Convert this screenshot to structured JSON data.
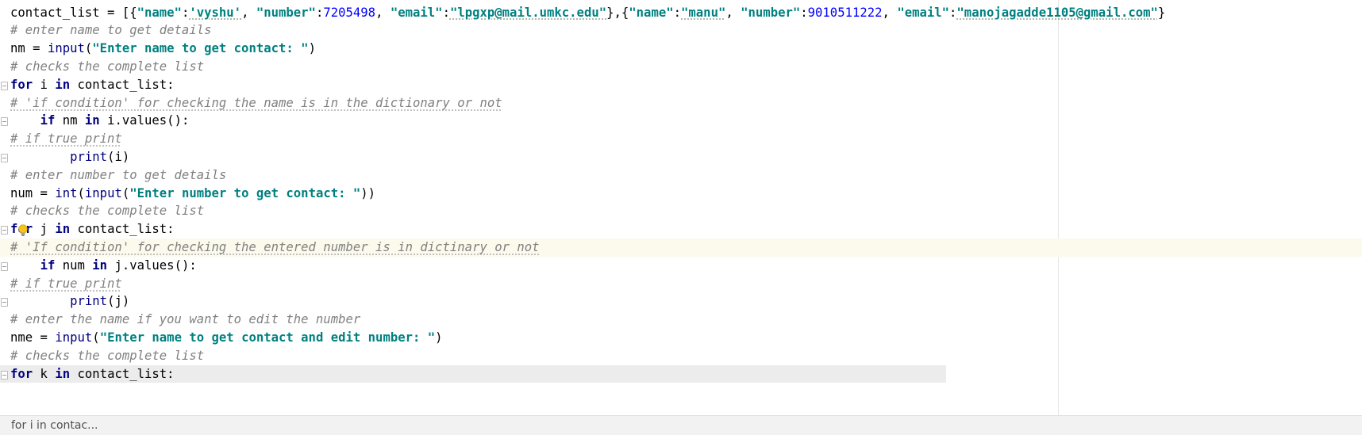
{
  "editor": {
    "lines": [
      {
        "fold": false,
        "tokens": [
          {
            "t": "contact_list = [{"
          },
          {
            "t": "\"name\"",
            "c": "str"
          },
          {
            "t": ":"
          },
          {
            "t": "'vyshu'",
            "c": "str squig"
          },
          {
            "t": ", "
          },
          {
            "t": "\"number\"",
            "c": "str"
          },
          {
            "t": ":"
          },
          {
            "t": "7205498",
            "c": "num"
          },
          {
            "t": ", "
          },
          {
            "t": "\"email\"",
            "c": "str"
          },
          {
            "t": ":"
          },
          {
            "t": "\"lpgxp@mail.umkc.edu\"",
            "c": "str squig"
          },
          {
            "t": "},{"
          },
          {
            "t": "\"name\"",
            "c": "str"
          },
          {
            "t": ":"
          },
          {
            "t": "\"manu\"",
            "c": "str squig"
          },
          {
            "t": ", "
          },
          {
            "t": "\"number\"",
            "c": "str"
          },
          {
            "t": ":"
          },
          {
            "t": "9010511222",
            "c": "num"
          },
          {
            "t": ", "
          },
          {
            "t": "\"email\"",
            "c": "str"
          },
          {
            "t": ":"
          },
          {
            "t": "\"manojagadde1105@gmail.com\"",
            "c": "str squig"
          },
          {
            "t": "}"
          }
        ]
      },
      {
        "fold": false,
        "tokens": [
          {
            "t": "# enter name to get details",
            "c": "cmt"
          }
        ]
      },
      {
        "fold": false,
        "tokens": [
          {
            "t": "nm = "
          },
          {
            "t": "input",
            "c": "bi"
          },
          {
            "t": "("
          },
          {
            "t": "\"Enter name to get contact: \"",
            "c": "str"
          },
          {
            "t": ")"
          }
        ]
      },
      {
        "fold": false,
        "tokens": [
          {
            "t": "# checks the complete list",
            "c": "cmt"
          }
        ]
      },
      {
        "fold": true,
        "tokens": [
          {
            "t": "for",
            "c": "kw"
          },
          {
            "t": " i "
          },
          {
            "t": "in",
            "c": "kw"
          },
          {
            "t": " contact_list:"
          }
        ]
      },
      {
        "fold": false,
        "tokens": [
          {
            "t": "# 'if condition' for checking the name is in the dictionary or not",
            "c": "cmt cmt-u"
          }
        ]
      },
      {
        "fold": true,
        "tokens": [
          {
            "t": "    "
          },
          {
            "t": "if",
            "c": "kw"
          },
          {
            "t": " nm "
          },
          {
            "t": "in",
            "c": "kw"
          },
          {
            "t": " i.values():"
          }
        ]
      },
      {
        "fold": false,
        "tokens": [
          {
            "t": "# if true print",
            "c": "cmt cmt-u"
          }
        ]
      },
      {
        "fold": true,
        "tokens": [
          {
            "t": "        "
          },
          {
            "t": "print",
            "c": "bi"
          },
          {
            "t": "(i)"
          }
        ]
      },
      {
        "fold": false,
        "tokens": [
          {
            "t": "# enter number to get details",
            "c": "cmt"
          }
        ]
      },
      {
        "fold": false,
        "tokens": [
          {
            "t": "num = "
          },
          {
            "t": "int",
            "c": "bi"
          },
          {
            "t": "("
          },
          {
            "t": "input",
            "c": "bi"
          },
          {
            "t": "("
          },
          {
            "t": "\"Enter number to get contact: \"",
            "c": "str"
          },
          {
            "t": "))"
          }
        ]
      },
      {
        "fold": false,
        "tokens": [
          {
            "t": "# checks the complete list",
            "c": "cmt"
          }
        ]
      },
      {
        "fold": true,
        "tokens": [
          {
            "t": "for",
            "c": "kw"
          },
          {
            "t": " j "
          },
          {
            "t": "in",
            "c": "kw"
          },
          {
            "t": " contact_list:"
          }
        ]
      },
      {
        "fold": false,
        "current": true,
        "tokens": [
          {
            "t": "# 'If condition' for checking the entered number is in dictinary or not",
            "c": "cmt cmt-u"
          }
        ]
      },
      {
        "fold": true,
        "tokens": [
          {
            "t": "    "
          },
          {
            "t": "if",
            "c": "kw"
          },
          {
            "t": " num "
          },
          {
            "t": "in",
            "c": "kw"
          },
          {
            "t": " j.values():"
          }
        ]
      },
      {
        "fold": false,
        "tokens": [
          {
            "t": "# if true print",
            "c": "cmt cmt-u"
          }
        ]
      },
      {
        "fold": true,
        "tokens": [
          {
            "t": "        "
          },
          {
            "t": "print",
            "c": "bi"
          },
          {
            "t": "(j)"
          }
        ]
      },
      {
        "fold": false,
        "tokens": [
          {
            "t": "# enter the name if you want to edit the number",
            "c": "cmt"
          }
        ]
      },
      {
        "fold": false,
        "tokens": [
          {
            "t": "nme = "
          },
          {
            "t": "input",
            "c": "bi"
          },
          {
            "t": "("
          },
          {
            "t": "\"Enter name to get contact and edit number: \"",
            "c": "str"
          },
          {
            "t": ")"
          }
        ]
      },
      {
        "fold": false,
        "tokens": [
          {
            "t": "# checks the complete list",
            "c": "cmt"
          }
        ]
      },
      {
        "fold": true,
        "sticky": true,
        "tokens": [
          {
            "t": "for",
            "c": "kw"
          },
          {
            "t": " k "
          },
          {
            "t": "in",
            "c": "kw"
          },
          {
            "t": " contact_list:"
          }
        ]
      }
    ]
  },
  "icons": {
    "intention": "lightbulb-icon"
  },
  "statusbar": {
    "breadcrumb": "for i in contac..."
  }
}
